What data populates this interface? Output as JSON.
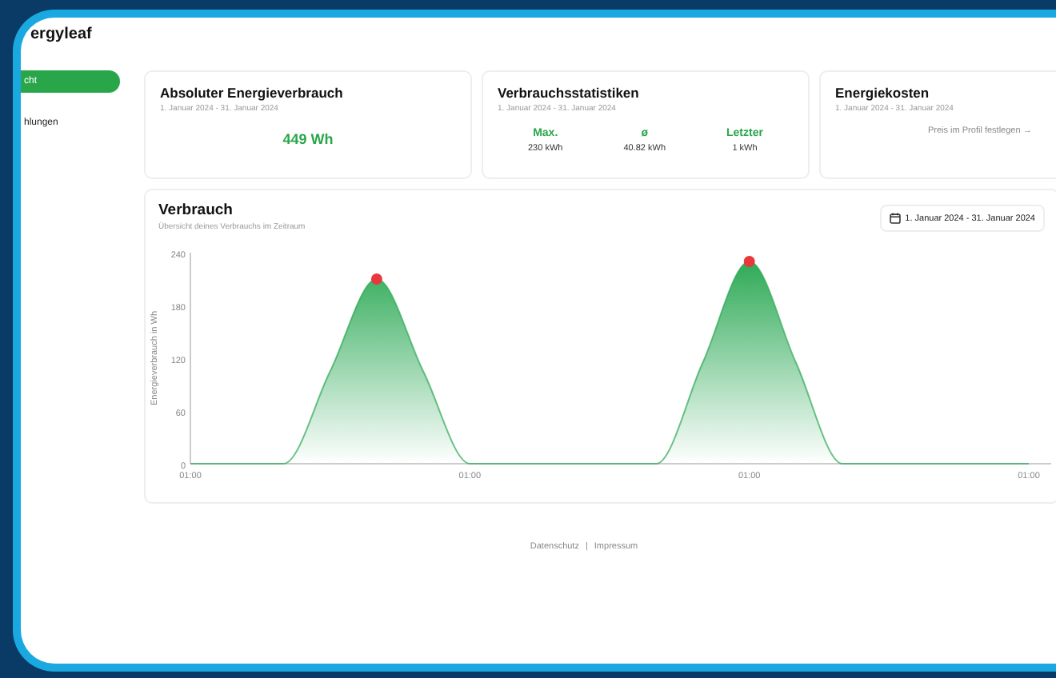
{
  "app": {
    "title": "ergyleaf"
  },
  "sidebar": {
    "items": [
      {
        "label": "cht",
        "selected": true
      },
      {
        "label": "hlungen",
        "selected": false
      }
    ]
  },
  "cards": [
    {
      "kind": "total",
      "title": "Absoluter Energieverbrauch",
      "subtitle": "1. Januar 2024 - 31. Januar 2024",
      "value": "449 Wh"
    },
    {
      "kind": "stats",
      "title": "Verbrauchsstatistiken",
      "subtitle": "1. Januar 2024 - 31. Januar 2024",
      "stats": [
        {
          "label": "Max.",
          "value": "230 kWh"
        },
        {
          "label": "ø",
          "value": "40.82 kWh"
        },
        {
          "label": "Letzter",
          "value": "1 kWh"
        }
      ]
    },
    {
      "kind": "link",
      "title": "Energiekosten",
      "subtitle": "1. Januar 2024 - 31. Januar 2024",
      "link": "Preis im Profil festlegen",
      "arrow": "→"
    }
  ],
  "usage": {
    "title": "Verbrauch",
    "subtitle": "Übersicht deines Verbrauchs im Zeitraum",
    "date_range": "1. Januar 2024 - 31. Januar 2024",
    "chart_data": {
      "type": "area",
      "ylabel": "Energieverbrauch in Wh",
      "categories": [
        "01:00",
        null,
        null,
        null,
        null,
        null,
        "01:00",
        null,
        null,
        null,
        null,
        null,
        "01:00",
        null,
        null,
        null,
        null,
        null,
        "01:00"
      ],
      "series": [
        {
          "color": "#2eaa57",
          "values": [
            0,
            0,
            0,
            105,
            210,
            105,
            0,
            0,
            0,
            0,
            0,
            115,
            230,
            115,
            0,
            0,
            0,
            0,
            0
          ]
        }
      ],
      "ylim": [
        0,
        240
      ],
      "yticks": [
        0,
        60,
        120,
        180,
        240
      ]
    }
  },
  "footer": {
    "links": [
      "Datenschutz",
      "Impressum"
    ],
    "separator": "|"
  }
}
